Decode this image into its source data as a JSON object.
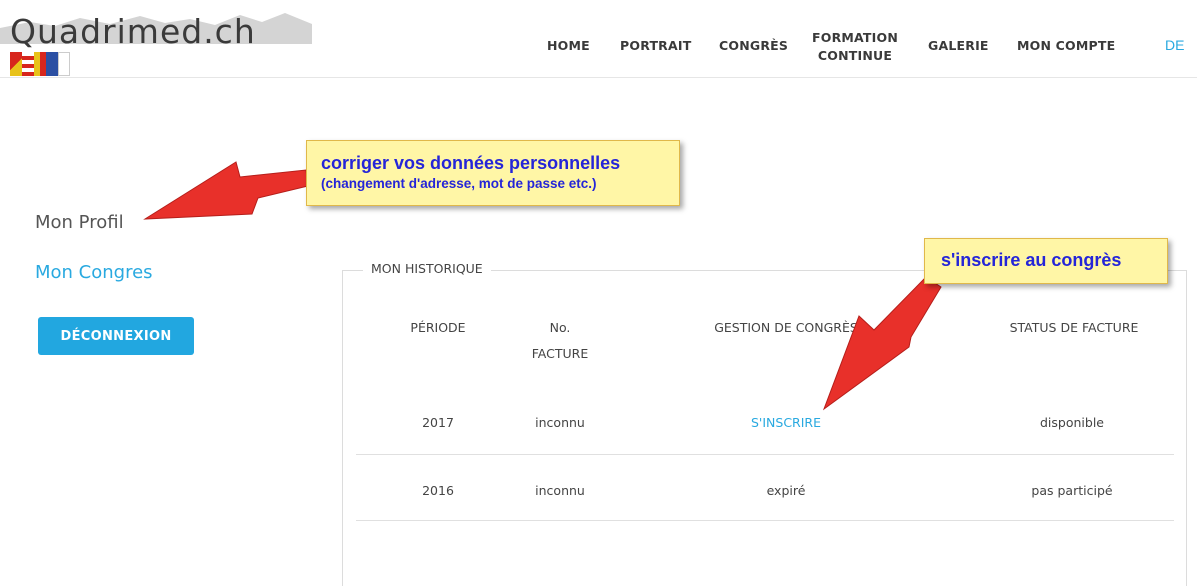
{
  "header": {
    "logo_text": "Quadrimed.ch",
    "nav": [
      {
        "label": "HOME"
      },
      {
        "label": "PORTRAIT"
      },
      {
        "label": "CONGRÈS"
      },
      {
        "label_line1": "FORMATION",
        "label_line2": "CONTINUE"
      },
      {
        "label": "GALERIE"
      },
      {
        "label": "MON COMPTE"
      }
    ],
    "language": "DE",
    "flag_colors": [
      "#d7261d",
      "#e8c21a",
      "#d7261d",
      "#ffffff",
      "#e8c21a",
      "#2b4fa3",
      "#ffffff"
    ]
  },
  "sidebar": {
    "profil": "Mon Profil",
    "congres": "Mon Congres",
    "logout": "DÉCONNEXION"
  },
  "history": {
    "legend": "MON HISTORIQUE",
    "headers": {
      "periode": "PÉRIODE",
      "facture_line1": "No.",
      "facture_line2": "FACTURE",
      "gestion": "GESTION DE CONGRÈS",
      "status": "STATUS DE FACTURE"
    },
    "rows": [
      {
        "periode": "2017",
        "facture": "inconnu",
        "gestion": "S'INSCRIRE",
        "status": "disponible"
      },
      {
        "periode": "2016",
        "facture": "inconnu",
        "gestion": "expiré",
        "status": "pas participé"
      }
    ]
  },
  "annotations": {
    "profile_title": "corriger vos données personnelles",
    "profile_subtitle": "(changement d'adresse, mot de passe etc.)",
    "register": "s'inscrire au congrès"
  },
  "colors": {
    "accent": "#29a9e0",
    "button": "#22a7e0",
    "callout_bg": "#fff6a6",
    "callout_text": "#2525d8",
    "arrow": "#e8302a"
  }
}
